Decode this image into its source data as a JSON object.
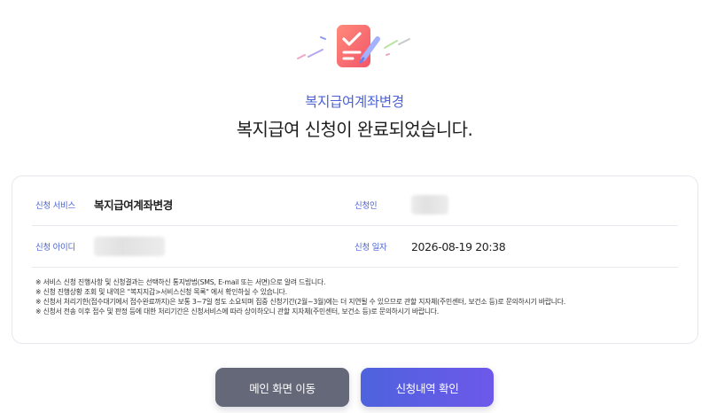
{
  "header": {
    "service_name": "복지급여계좌변경",
    "completion_message": "복지급여 신청이 완료되었습니다."
  },
  "details": {
    "service": {
      "label": "신청 서비스",
      "value": "복지급여계좌변경"
    },
    "applicant": {
      "label": "신청인"
    },
    "applicant_id": {
      "label": "신청 아이디"
    },
    "date": {
      "label": "신청 일자",
      "value": "2026-08-19 20:38"
    }
  },
  "notes": [
    "※ 서비스 신청 진행사항 및 신청결과는 선택하신 통지방법(SMS, E-mail 또는 서면)으로 알려 드립니다.",
    "※ 신청 진행상황 조회 및 내역은 \"복지지갑>서비스신청 목록\" 에서 확인하실 수 있습니다.",
    "※ 신청서 처리기한(접수대기에서 접수완료까지)은 보통 3~7일 정도 소요되며 집중 신청기간(2월~3월)에는 더 지연될 수 있으므로 관할 지자체(주민센터, 보건소 등)로 문의하시기 바랍니다.",
    "※ 신청서 전송 이후 접수 및 판정 등에 대한 처리기간은 신청서비스에 따라 상이하오니 관할 지자체(주민센터, 보건소 등)로 문의하시기 바랍니다."
  ],
  "buttons": {
    "main": "메인 화면 이동",
    "history": "신청내역 확인"
  },
  "colors": {
    "accent": "#4b63d6",
    "main_button": "#646878",
    "history_button_start": "#4e63dd",
    "history_button_end": "#6d58ea"
  },
  "icons": {
    "hero": "clipboard-check-icon"
  }
}
